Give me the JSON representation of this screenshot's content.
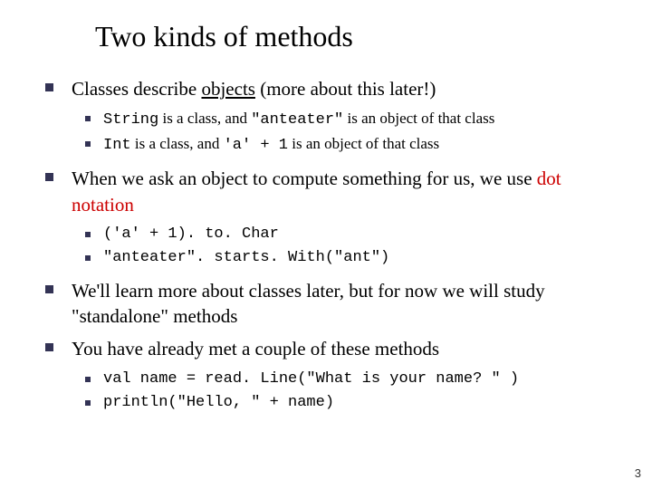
{
  "title": "Two kinds of methods",
  "bullets": {
    "b1": {
      "pre": "Classes describe ",
      "obj": "objects",
      "post": " (more about this later!)",
      "sub": {
        "s1": {
          "code1": "String",
          "mid": " is a class, and ",
          "code2": "\"anteater\"",
          "tail": " is an object of that class"
        },
        "s2": {
          "code1": "Int",
          "mid": " is a class, and ",
          "code2": "'a' + 1",
          "tail": " is an object of that class"
        }
      }
    },
    "b2": {
      "pre": "When we ask an object to compute something for us, we use ",
      "dot": "dot notation",
      "sub": {
        "s1": "('a' + 1). to. Char",
        "s2": "\"anteater\". starts. With(\"ant\")"
      }
    },
    "b3": "We'll learn more about classes later, but for now we will study \"standalone\" methods",
    "b4": {
      "text": "You have already met a couple of these methods",
      "sub": {
        "s1": "val name = read. Line(\"What is your name? \" )",
        "s2": "println(\"Hello, \" + name)"
      }
    }
  },
  "pagenum": "3"
}
